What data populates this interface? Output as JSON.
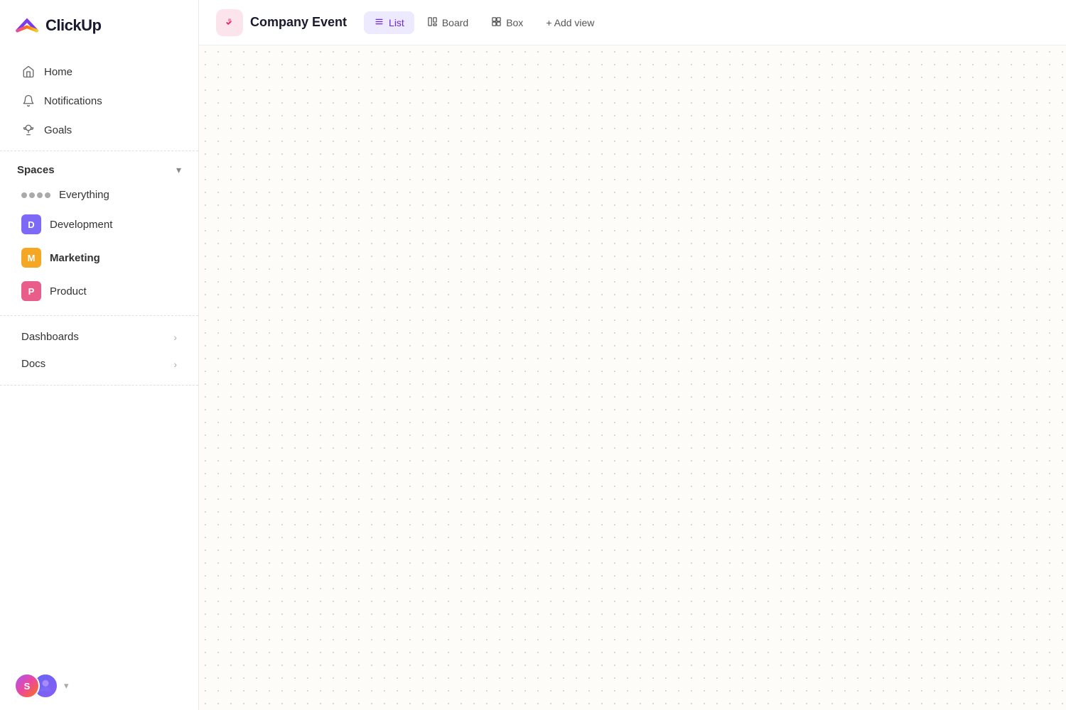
{
  "app": {
    "name": "ClickUp"
  },
  "sidebar": {
    "nav": [
      {
        "id": "home",
        "label": "Home",
        "icon": "home"
      },
      {
        "id": "notifications",
        "label": "Notifications",
        "icon": "bell"
      },
      {
        "id": "goals",
        "label": "Goals",
        "icon": "trophy"
      }
    ],
    "spaces_label": "Spaces",
    "spaces": [
      {
        "id": "everything",
        "label": "Everything",
        "type": "dots"
      },
      {
        "id": "development",
        "label": "Development",
        "type": "badge",
        "letter": "D",
        "color": "badge-blue"
      },
      {
        "id": "marketing",
        "label": "Marketing",
        "type": "badge",
        "letter": "M",
        "color": "badge-yellow",
        "active": true
      },
      {
        "id": "product",
        "label": "Product",
        "type": "badge",
        "letter": "P",
        "color": "badge-pink"
      }
    ],
    "bottom_nav": [
      {
        "id": "dashboards",
        "label": "Dashboards"
      },
      {
        "id": "docs",
        "label": "Docs"
      }
    ],
    "footer": {
      "avatar1_label": "S",
      "chevron_label": "▾"
    }
  },
  "topbar": {
    "project_title": "Company Event",
    "views": [
      {
        "id": "list",
        "label": "List",
        "icon": "≡",
        "active": true
      },
      {
        "id": "board",
        "label": "Board",
        "icon": "⊞",
        "active": false
      },
      {
        "id": "box",
        "label": "Box",
        "icon": "⊟",
        "active": false
      }
    ],
    "add_view_label": "+ Add view"
  }
}
